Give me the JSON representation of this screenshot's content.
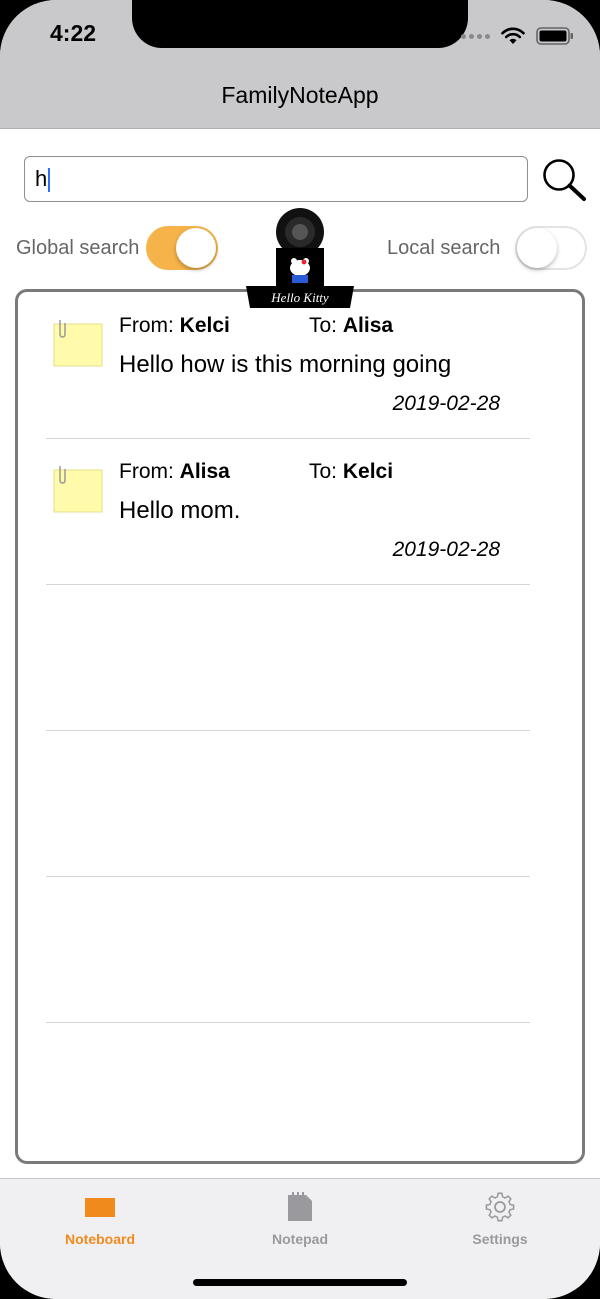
{
  "status_bar": {
    "time": "4:22"
  },
  "nav": {
    "title": "FamilyNoteApp"
  },
  "search": {
    "value": "h"
  },
  "toggles": {
    "global_label": "Global search",
    "global_on": true,
    "local_label": "Local search",
    "local_on": false
  },
  "clip": {
    "label": "Hello Kitty"
  },
  "notes": [
    {
      "from_label": "From:",
      "from": "Kelci",
      "to_label": "To:",
      "to": "Alisa",
      "message": "Hello how is this morning going",
      "date": "2019-02-28"
    },
    {
      "from_label": "From:",
      "from": "Alisa",
      "to_label": "To:",
      "to": "Kelci",
      "message": "Hello mom.",
      "date": "2019-02-28"
    }
  ],
  "tabs": [
    {
      "label": "Noteboard",
      "icon": "noteboard-icon",
      "active": true
    },
    {
      "label": "Notepad",
      "icon": "notepad-icon",
      "active": false
    },
    {
      "label": "Settings",
      "icon": "gear-icon",
      "active": false
    }
  ],
  "colors": {
    "accent": "#f5b34a",
    "tab_active": "#f08a1c",
    "tab_inactive": "#9a9a9e",
    "nav_bg": "#c9c9cb"
  }
}
